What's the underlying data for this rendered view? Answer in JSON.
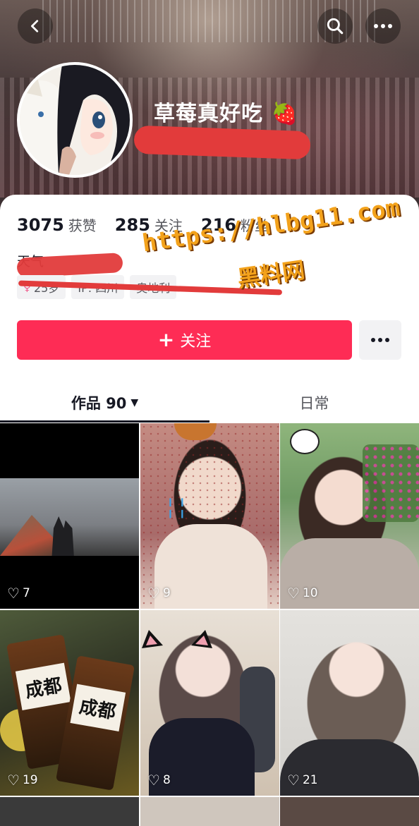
{
  "header": {
    "nickname": "草莓真好吃",
    "nickname_emoji": "🍓"
  },
  "stats": [
    {
      "value": "3075",
      "label": "获赞"
    },
    {
      "value": "285",
      "label": "关注"
    },
    {
      "value": "216",
      "label": "粉丝"
    }
  ],
  "bio": {
    "text": "天气"
  },
  "tags": {
    "age": "25岁",
    "ip": "IP: 四川",
    "location": "奥地利"
  },
  "watermark": {
    "url": "https://hlbg11.com",
    "name": "黑料网"
  },
  "actions": {
    "follow_label": "关注",
    "follow_plus": "+",
    "more": "•••"
  },
  "tabs": {
    "works": "作品 90",
    "works_caret": "▼",
    "daily": "日常"
  },
  "grid": [
    {
      "likes": "7"
    },
    {
      "likes": "9"
    },
    {
      "likes": "10"
    },
    {
      "likes": "19",
      "cup_text_1": "成都",
      "cup_text_2": "成都"
    },
    {
      "likes": "8"
    },
    {
      "likes": "21"
    }
  ],
  "colors": {
    "primary": "#fe2c55",
    "text": "#161823",
    "watermark": "#f3a21b"
  }
}
